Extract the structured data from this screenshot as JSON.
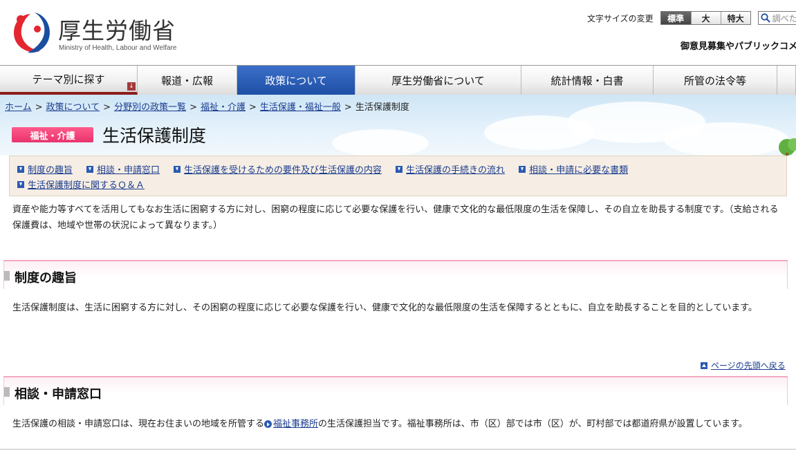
{
  "header": {
    "logo_title": "厚生労働省",
    "logo_subtitle": "Ministry of Health, Labour and Welfare",
    "fontsize_label": "文字サイズの変更",
    "fontsize_options": [
      "標準",
      "大",
      "特大"
    ],
    "search_placeholder": "調べた",
    "pubcomment_link": "御意見募集やパブリックコメ"
  },
  "gnav": {
    "items": [
      "テーマ別に探す",
      "報道・広報",
      "政策について",
      "厚生労働省について",
      "統計情報・白書",
      "所管の法令等"
    ],
    "active_index": 2,
    "dropdown_mark": "↓"
  },
  "breadcrumb": {
    "items": [
      "ホーム",
      "政策について",
      "分野別の政策一覧",
      "福祉・介護",
      "生活保護・福祉一般"
    ],
    "current": "生活保護制度",
    "separator": ">"
  },
  "page": {
    "category_badge": "福祉・介護",
    "title": "生活保護制度"
  },
  "anchors": {
    "row1": [
      "制度の趣旨",
      "相談・申請窓口",
      "生活保護を受けるための要件及び生活保護の内容",
      "生活保護の手続きの流れ",
      "相談・申請に必要な書類"
    ],
    "row2": [
      "生活保護制度に関するＱ＆Ａ"
    ]
  },
  "intro": "資産や能力等すべてを活用してもなお生活に困窮する方に対し、困窮の程度に応じて必要な保護を行い、健康で文化的な最低限度の生活を保障し、その自立を助長する制度です。（支給される保護費は、地域や世帯の状況によって異なります。）",
  "sections": [
    {
      "heading": "制度の趣旨",
      "body": "生活保護制度は、生活に困窮する方に対し、その困窮の程度に応じて必要な保護を行い、健康で文化的な最低限度の生活を保障するとともに、自立を助長することを目的としています。"
    },
    {
      "heading": "相談・申請窓口",
      "body_before": "生活保護の相談・申請窓口は、現在お住まいの地域を所管する",
      "body_link": "福祉事務所",
      "body_after": "の生活保護担当です。福祉事務所は、市（区）部では市（区）が、町村部では都道府県が設置しています。"
    }
  ],
  "pagetop_label": "ページの先頭へ戻る",
  "colors": {
    "nav_active": "#2d5fb8",
    "badge_pink": "#ee3f76",
    "link_blue": "#1a3c8f",
    "logo_red": "#e3262f",
    "logo_blue": "#1b4da0"
  }
}
